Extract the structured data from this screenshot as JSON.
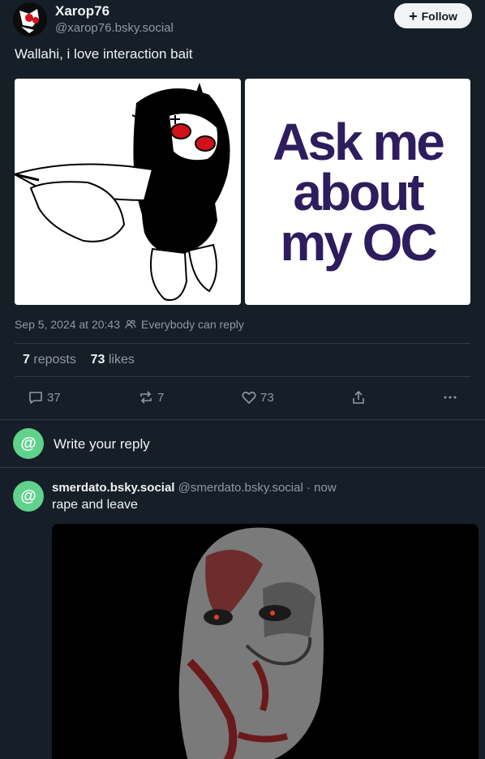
{
  "post": {
    "author_name": "Xarop76",
    "author_handle": "@xarop76.bsky.social",
    "follow_label": "Follow",
    "text": "Wallahi, i love interaction bait",
    "image_right_lines": [
      "Ask me",
      "about",
      "my OC"
    ],
    "timestamp": "Sep 5, 2024 at 20:43",
    "reply_setting": "Everybody can reply",
    "reposts_count": "7",
    "reposts_label": "reposts",
    "likes_count": "73",
    "likes_label": "likes",
    "actions": {
      "replies": "37",
      "reposts": "7",
      "likes": "73"
    }
  },
  "compose": {
    "placeholder": "Write your reply"
  },
  "reply": {
    "name": "smerdato.bsky.social",
    "handle": "@smerdato.bsky.social",
    "time": "· now",
    "text": "rape and leave"
  },
  "colors": {
    "background": "#161e27",
    "muted": "#8d9aa8",
    "divider": "#2e3a46",
    "default_avatar": "#5fd28c",
    "oc_text": "#2d1d5e"
  }
}
